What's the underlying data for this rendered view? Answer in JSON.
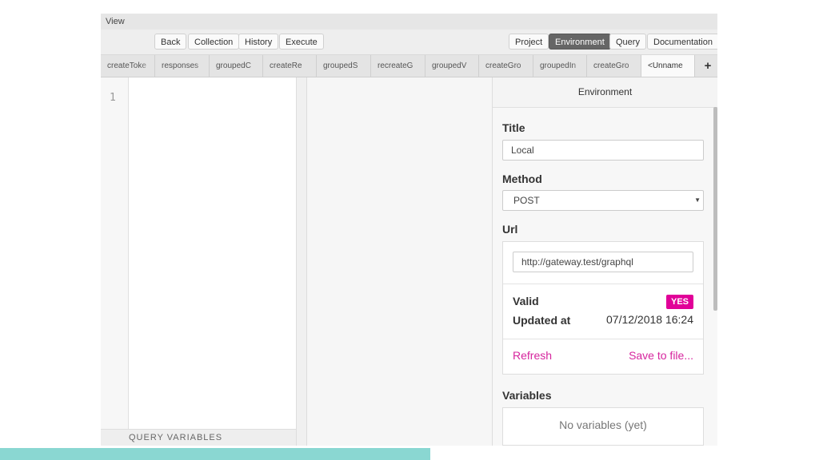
{
  "menubar": {
    "view": "View"
  },
  "toolbar": {
    "back": "Back",
    "collection": "Collection",
    "history": "History",
    "execute": "Execute",
    "project": "Project",
    "environment": "Environment",
    "query": "Query",
    "documentation": "Documentation",
    "active": "Environment"
  },
  "tabs": [
    {
      "label": "createToke"
    },
    {
      "label": "responses"
    },
    {
      "label": "groupedC"
    },
    {
      "label": "createRe"
    },
    {
      "label": "groupedS"
    },
    {
      "label": "recreateG"
    },
    {
      "label": "groupedV"
    },
    {
      "label": "createGro"
    },
    {
      "label": "groupedIn"
    },
    {
      "label": "createGro"
    },
    {
      "label": "<Unname",
      "active": true
    }
  ],
  "tab_add": "+",
  "editor": {
    "line_number": "1"
  },
  "query_variables": "QUERY VARIABLES",
  "panel": {
    "heading": "Environment",
    "title_label": "Title",
    "title_value": "Local",
    "method_label": "Method",
    "method_value": "POST",
    "url_label": "Url",
    "url_value": "http://gateway.test/graphql",
    "valid_label": "Valid",
    "valid_badge": "YES",
    "updated_label": "Updated at",
    "updated_value": "07/12/2018 16:24",
    "refresh": "Refresh",
    "save": "Save to file...",
    "variables_label": "Variables",
    "variables_empty": "No variables (yet)"
  },
  "colors": {
    "accent": "#e10098",
    "link": "#d6259e",
    "active_button": "#666666",
    "slide_bar": "#8ad7d2"
  }
}
